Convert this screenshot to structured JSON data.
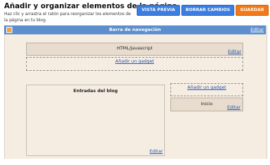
{
  "header": {
    "title": "Añadir y organizar elementos de la página",
    "description": "Haz clic y arrastra el ratón para reorganizar los elementos de la página en tu blog."
  },
  "toolbar": {
    "preview_label": "VISTA PREVIA",
    "clear_label": "BORRAR CAMBIOS",
    "save_label": "GUARDAR"
  },
  "navbar": {
    "title": "Barra de navegación",
    "edit_label": "Editar"
  },
  "header_section": {
    "gadget_title": "HTML/Javascript",
    "edit_label": "Editar",
    "add_gadget_label": "Añadir un gadget"
  },
  "main": {
    "title": "Entradas del blog",
    "edit_label": "Editar"
  },
  "sidebar": {
    "add_gadget_label": "Añadir un gadget",
    "gadget_title": "Inicio",
    "edit_label": "Editar"
  }
}
